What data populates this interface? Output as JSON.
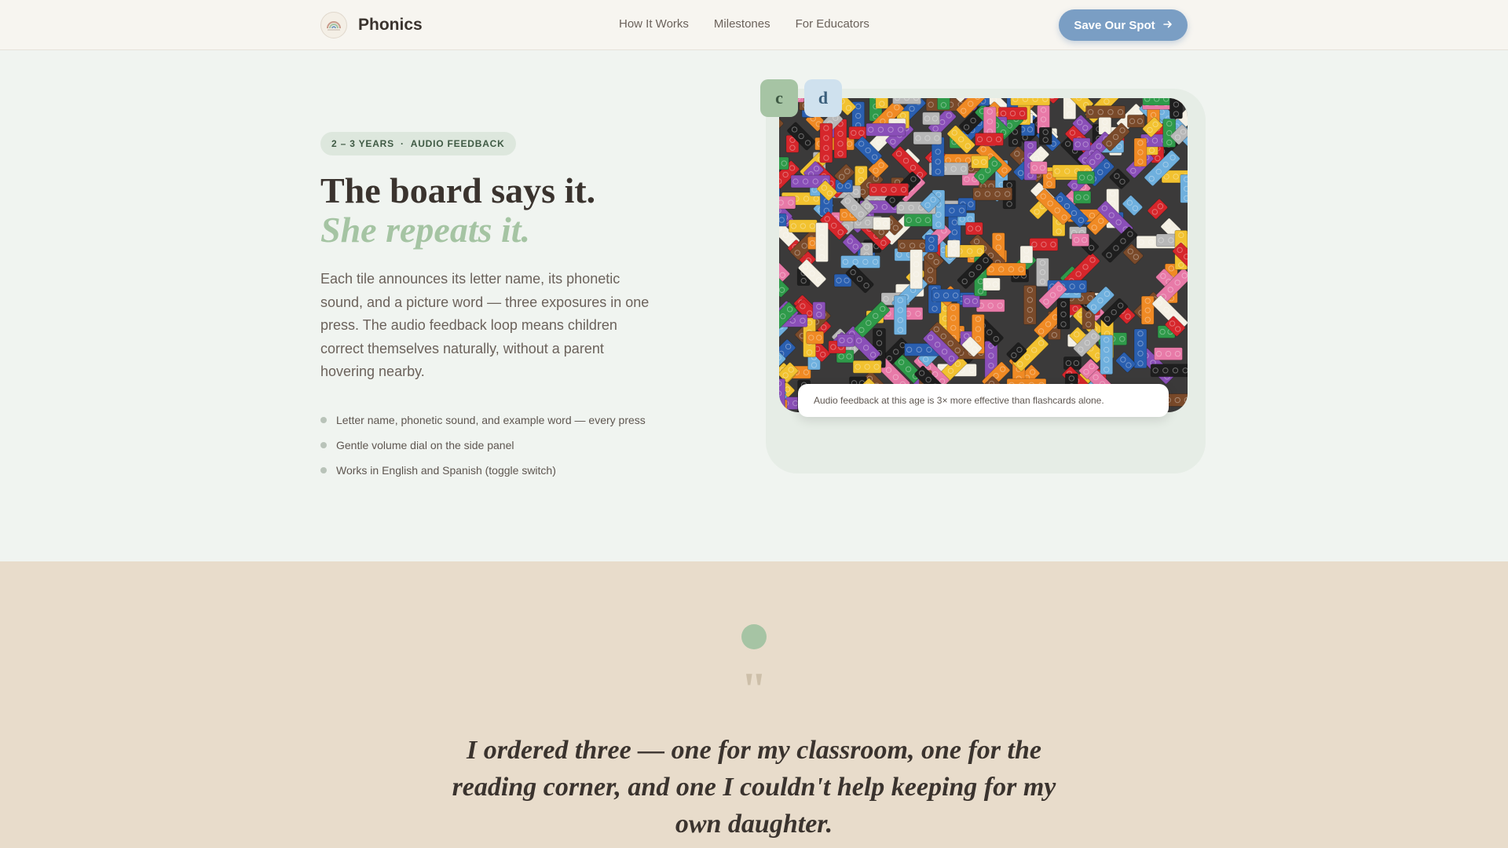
{
  "nav": {
    "brand": "Phonics",
    "logo_icon": "rainbow-logo-icon",
    "links": [
      "How It Works",
      "Milestones",
      "For Educators"
    ],
    "cta_label": "Save Our Spot",
    "cta_icon": "arrow-right-icon"
  },
  "hero": {
    "badge_age": "2 – 3 YEARS",
    "badge_sep": "·",
    "badge_feature": "AUDIO FEEDBACK",
    "title_line1": "The board says it.",
    "title_line2": "She repeats it.",
    "lede": "Each tile announces its letter name, its phonetic sound, and a picture word — three exposures in one press. The audio feedback loop means children correct themselves naturally, without a parent hovering nearby.",
    "bullets": [
      "Letter name, phonetic sound, and example word — every press",
      "Gentle volume dial on the side panel",
      "Works in English and Spanish (toggle switch)"
    ]
  },
  "media": {
    "tile_c": "c",
    "tile_d": "d",
    "photo_subject": "pile of colorful toy building bricks",
    "caption": "Audio feedback at this age is 3× more effective than flashcards alone."
  },
  "testimonial": {
    "quote_mark": "\"",
    "text": "I ordered three — one for my classroom, one for the reading corner, and one I couldn't help keeping for my own daughter."
  },
  "colors": {
    "accent_blue": "#7a9ec4",
    "sage": "#a6c4a4",
    "hero_bg": "#f0f4f0",
    "quote_bg": "#e8dccb"
  }
}
